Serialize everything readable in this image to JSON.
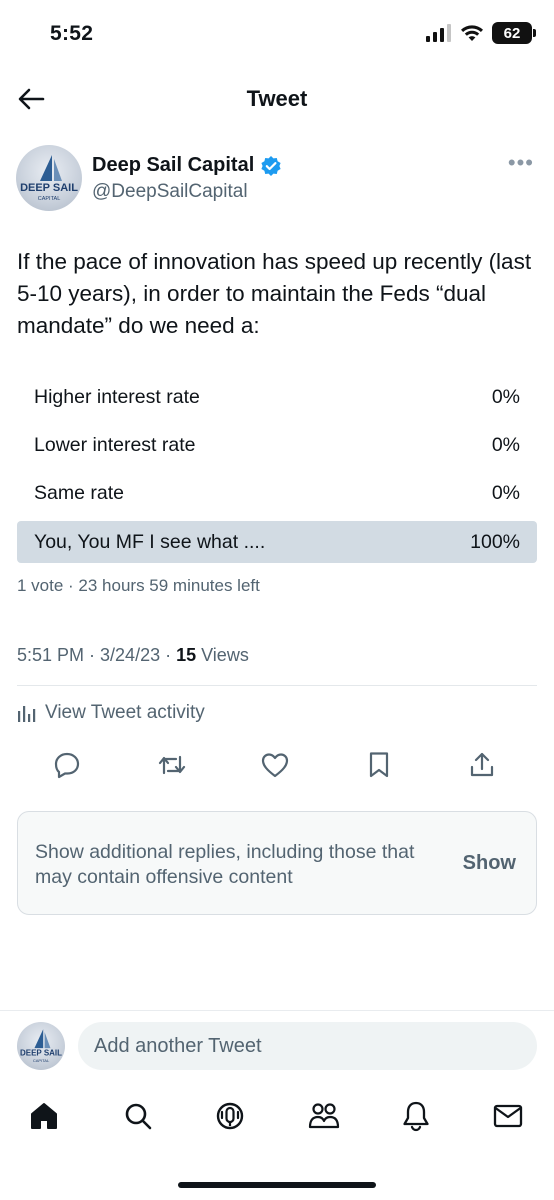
{
  "status_bar": {
    "time": "5:52",
    "battery": "62"
  },
  "header": {
    "title": "Tweet"
  },
  "author": {
    "name": "Deep Sail Capital",
    "handle": "@DeepSailCapital",
    "avatar_text": "DEEP SAIL",
    "avatar_subtext": "CAPITAL",
    "verified": true
  },
  "tweet": {
    "text": "If the pace of innovation has speed up recently (last 5-10 years), in order to maintain the Feds “dual mandate” do we need a:"
  },
  "poll": {
    "options": [
      {
        "label": "Higher interest rate",
        "percent": "0%"
      },
      {
        "label": "Lower interest rate",
        "percent": "0%"
      },
      {
        "label": "Same rate",
        "percent": "0%"
      },
      {
        "label": "You, You MF I see what ....",
        "percent": "100%"
      }
    ],
    "meta": "1 vote · 23 hours 59 minutes left"
  },
  "timestamp": {
    "time": "5:51 PM · 3/24/23 · ",
    "views_count": "15",
    "views_label": " Views"
  },
  "activity": {
    "label": "View Tweet activity"
  },
  "notice": {
    "text": "Show additional replies, including those that may contain offensive content",
    "button": "Show"
  },
  "reply": {
    "placeholder": "Add another Tweet"
  },
  "colors": {
    "accent": "#1d9bf0",
    "muted": "#536471",
    "poll_winner": "#d2dbe3"
  }
}
